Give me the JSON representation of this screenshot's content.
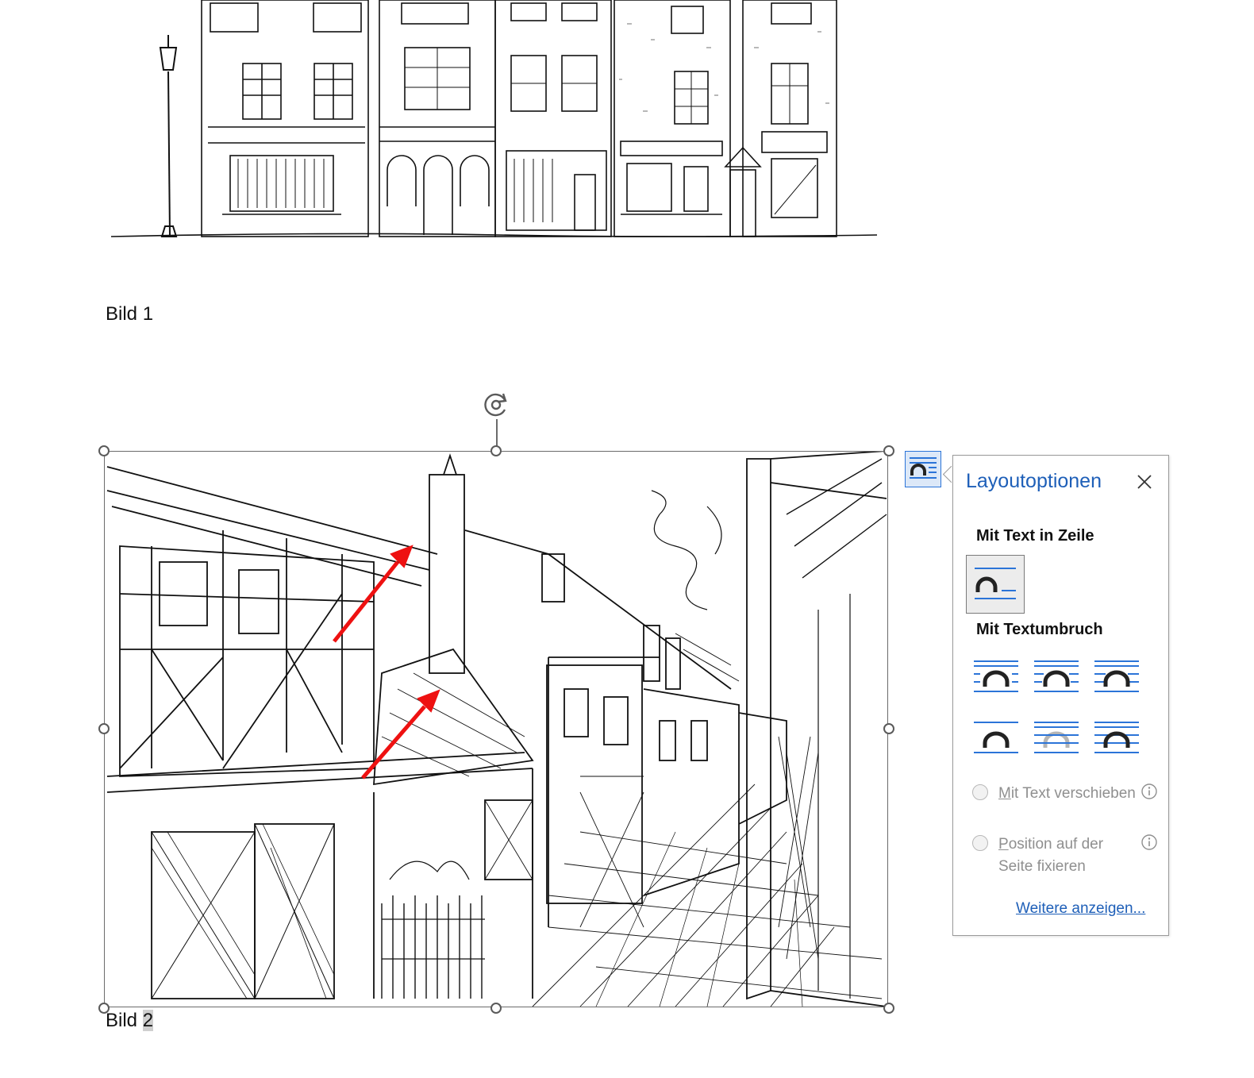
{
  "document": {
    "caption1": {
      "prefix": "Bild ",
      "number": "1"
    },
    "caption2": {
      "prefix": "Bild ",
      "number": "2"
    }
  },
  "layout_panel": {
    "title": "Layoutoptionen",
    "section_inline": "Mit Text in Zeile",
    "section_wrap": "Mit Textumbruch",
    "radio_move": {
      "access_key": "M",
      "rest": "it Text verschieben"
    },
    "radio_fixed": {
      "access_key": "P",
      "rest": "osition auf der Seite fixieren"
    },
    "more_link": "Weitere anzeigen..."
  },
  "colors": {
    "accent": "#1e5fb8",
    "wrap_lines": "#2b74d8",
    "annotation_arrow": "#ee1111"
  },
  "icons": {
    "rotate": "rotate-handle-icon",
    "close": "close-icon",
    "info": "info-icon",
    "layout_options": "layout-options-icon"
  }
}
